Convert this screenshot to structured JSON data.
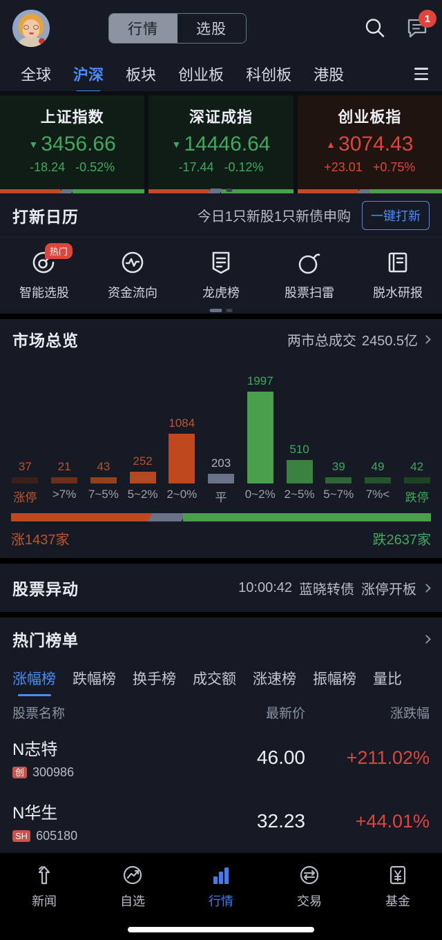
{
  "topbar": {
    "avatar_name": "user-avatar",
    "segment": {
      "active": "行情",
      "inactive": "选股"
    },
    "search_icon": "search-icon",
    "message_icon": "message-icon",
    "badge_count": "1"
  },
  "category_nav": {
    "items": [
      {
        "label": "全球",
        "active": false
      },
      {
        "label": "沪深",
        "active": true
      },
      {
        "label": "板块",
        "active": false
      },
      {
        "label": "创业板",
        "active": false
      },
      {
        "label": "科创板",
        "active": false
      },
      {
        "label": "港股",
        "active": false
      }
    ],
    "menu_icon": "hamburger-icon"
  },
  "index_cards": [
    {
      "name": "上证指数",
      "value": "3456.66",
      "arrow": "▼",
      "change": "-18.24",
      "percent": "-0.52%",
      "direction": "down"
    },
    {
      "name": "深证成指",
      "value": "14446.64",
      "arrow": "▼",
      "change": "-17.44",
      "percent": "-0.12%",
      "direction": "down"
    },
    {
      "name": "创业板指",
      "value": "3074.43",
      "arrow": "▲",
      "change": "+23.01",
      "percent": "+0.75%",
      "direction": "up"
    }
  ],
  "ipo": {
    "title": "打新日历",
    "message": "今日1只新股1只新债申购",
    "button": "一键打新"
  },
  "features": [
    {
      "label": "智能选股",
      "icon": "smart-stock-picker-icon",
      "badge": "热门"
    },
    {
      "label": "资金流向",
      "icon": "capital-flow-icon",
      "badge": ""
    },
    {
      "label": "龙虎榜",
      "icon": "dragon-tiger-list-icon",
      "badge": ""
    },
    {
      "label": "股票扫雷",
      "icon": "stock-minesweeper-icon",
      "badge": ""
    },
    {
      "label": "脱水研报",
      "icon": "research-report-icon",
      "badge": ""
    }
  ],
  "market_overview": {
    "title": "市场总览",
    "turnover_label": "两市总成交",
    "turnover_value": "2450.5亿",
    "ratio": {
      "up_label": "涨1437家",
      "down_label": "跌2637家",
      "up_count": 1437,
      "down_count": 2637
    }
  },
  "chart_data": {
    "type": "bar",
    "title": "市场总览",
    "categories": [
      "涨停",
      ">7%",
      "7~5%",
      "5~2%",
      "2~0%",
      "平",
      "0~2%",
      "2~5%",
      "5~7%",
      "7%<",
      "跌停"
    ],
    "values": [
      37,
      21,
      43,
      252,
      1084,
      203,
      1997,
      510,
      39,
      49,
      42
    ],
    "colors": [
      "#3a2018",
      "#6a3019",
      "#93401d",
      "#b14a20",
      "#c0481f",
      "#6a7288",
      "#4a9f4c",
      "#3b8240",
      "#2f6636",
      "#26532c",
      "#1d4224"
    ],
    "label_colors": [
      "#b5542c",
      "#b5542c",
      "#b5542c",
      "#b5542c",
      "#c0552c",
      "#aeb4c2",
      "#3fa95f",
      "#3fa95f",
      "#3fa95f",
      "#3fa95f",
      "#3fa95f"
    ],
    "xlabel": "",
    "ylabel": "",
    "ylim": [
      0,
      1997
    ],
    "grid": false,
    "legend": "none"
  },
  "stock_alert": {
    "title": "股票异动",
    "time": "10:00:42",
    "name": "蓝晓转债",
    "event": "涨停开板"
  },
  "hot_list": {
    "title": "热门榜单",
    "tabs": [
      {
        "label": "涨幅榜",
        "active": true
      },
      {
        "label": "跌幅榜",
        "active": false
      },
      {
        "label": "换手榜",
        "active": false
      },
      {
        "label": "成交额",
        "active": false
      },
      {
        "label": "涨速榜",
        "active": false
      },
      {
        "label": "振幅榜",
        "active": false
      },
      {
        "label": "量比",
        "active": false
      }
    ],
    "headers": {
      "name": "股票名称",
      "price": "最新价",
      "change": "涨跌幅"
    },
    "rows": [
      {
        "name": "N志特",
        "tag": "创",
        "code": "300986",
        "price": "46.00",
        "change": "+211.02%"
      },
      {
        "name": "N华生",
        "tag": "SH",
        "code": "605180",
        "price": "32.23",
        "change": "+44.01%"
      }
    ]
  },
  "bottom_nav": [
    {
      "label": "新闻",
      "icon": "news-arrow-icon",
      "active": false
    },
    {
      "label": "自选",
      "icon": "watchlist-trend-icon",
      "active": false
    },
    {
      "label": "行情",
      "icon": "market-bars-icon",
      "active": true
    },
    {
      "label": "交易",
      "icon": "trade-exchange-icon",
      "active": false
    },
    {
      "label": "基金",
      "icon": "fund-yuan-icon",
      "active": false
    }
  ],
  "colors": {
    "accent": "#4a8cf7",
    "up_red": "#e0453c",
    "down_green": "#3fa95f",
    "bg": "#12151d",
    "panel": "#161a24"
  }
}
